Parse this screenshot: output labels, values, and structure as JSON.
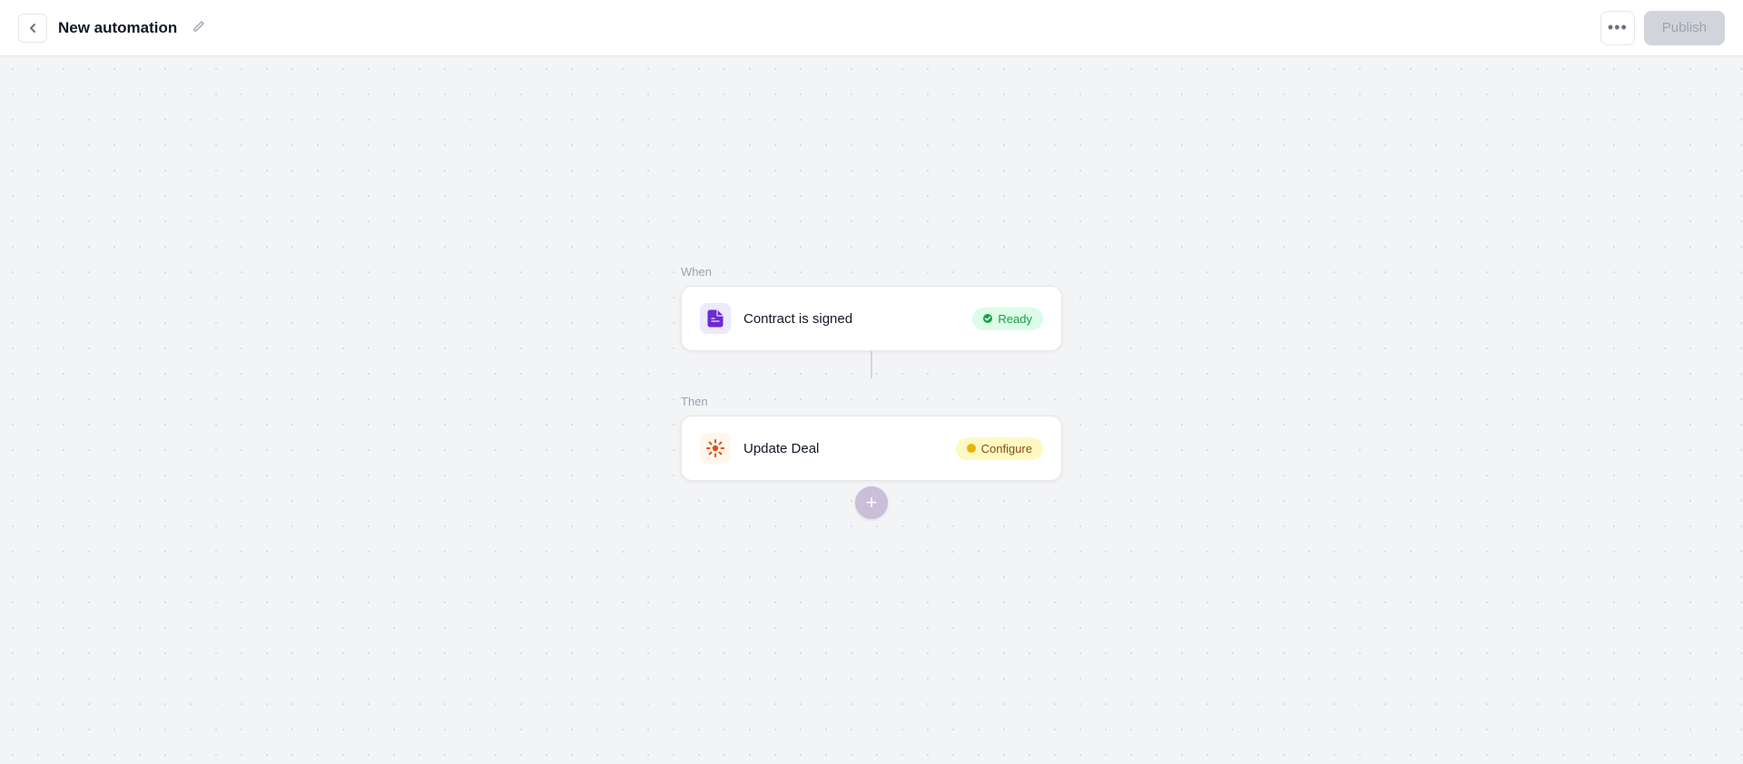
{
  "header": {
    "title": "New automation",
    "back_label": "‹",
    "edit_icon": "✏",
    "more_label": "•••",
    "publish_label": "Publish"
  },
  "flow": {
    "when_label": "When",
    "then_label": "Then",
    "trigger": {
      "name": "Contract is signed",
      "status": "Ready",
      "icon": "📄"
    },
    "action": {
      "name": "Update Deal",
      "status": "Configure",
      "icon": "🔶"
    },
    "add_label": "+"
  }
}
